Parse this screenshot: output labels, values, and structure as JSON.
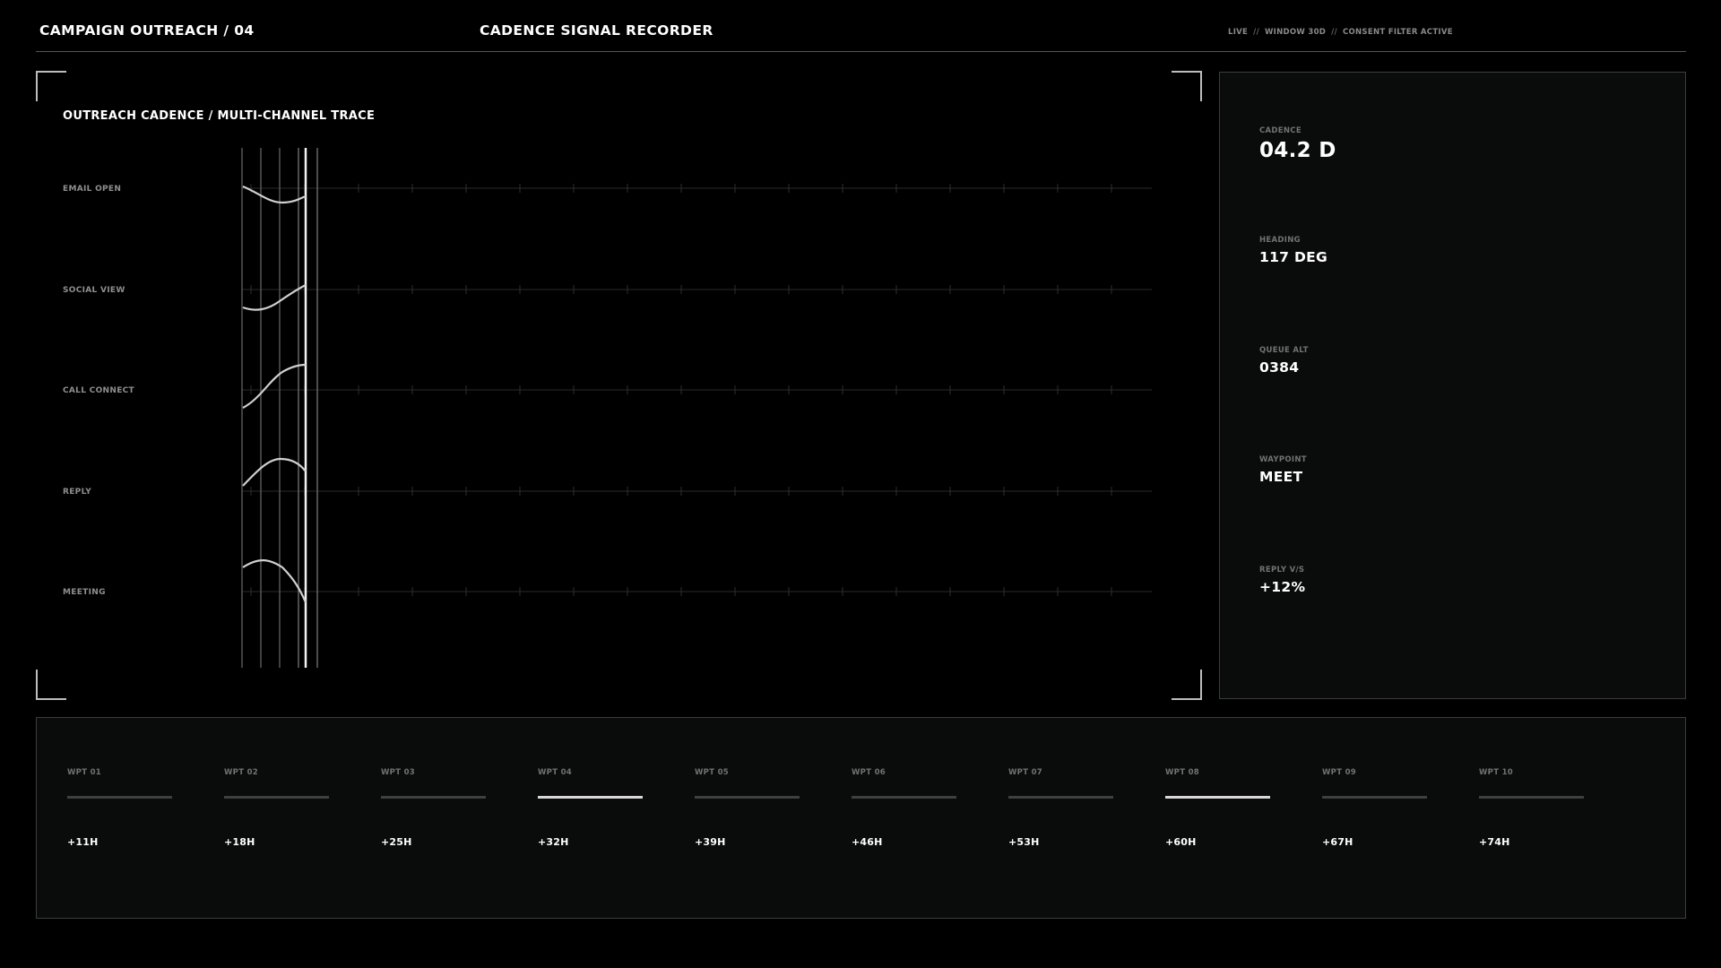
{
  "header": {
    "left_title": "CAMPAIGN OUTREACH / 04",
    "center_title": "CADENCE SIGNAL RECORDER",
    "status": [
      "LIVE",
      "WINDOW 30D",
      "CONSENT FILTER ACTIVE"
    ],
    "status_separator": "//"
  },
  "chart": {
    "title": "OUTREACH CADENCE / MULTI-CHANNEL TRACE",
    "lanes": [
      {
        "label": "EMAIL OPEN"
      },
      {
        "label": "SOCIAL VIEW"
      },
      {
        "label": "CALL CONNECT"
      },
      {
        "label": "REPLY"
      },
      {
        "label": "MEETING"
      }
    ]
  },
  "stats": [
    {
      "label": "CADENCE",
      "value": "04.2 D"
    },
    {
      "label": "HEADING",
      "value": "117 DEG"
    },
    {
      "label": "QUEUE ALT",
      "value": "0384"
    },
    {
      "label": "WAYPOINT",
      "value": "MEET"
    },
    {
      "label": "REPLY V/S",
      "value": "+12%"
    }
  ],
  "waypoints": [
    {
      "label": "WPT 01",
      "offset": "+11H",
      "active": false
    },
    {
      "label": "WPT 02",
      "offset": "+18H",
      "active": false
    },
    {
      "label": "WPT 03",
      "offset": "+25H",
      "active": false
    },
    {
      "label": "WPT 04",
      "offset": "+32H",
      "active": true
    },
    {
      "label": "WPT 05",
      "offset": "+39H",
      "active": false
    },
    {
      "label": "WPT 06",
      "offset": "+46H",
      "active": false
    },
    {
      "label": "WPT 07",
      "offset": "+53H",
      "active": false
    },
    {
      "label": "WPT 08",
      "offset": "+60H",
      "active": true
    },
    {
      "label": "WPT 09",
      "offset": "+67H",
      "active": false
    },
    {
      "label": "WPT 10",
      "offset": "+74H",
      "active": false
    }
  ],
  "colors": {
    "background": "#000000",
    "panel": "#0a0c0b",
    "border": "#3a3d3b",
    "trace": "#d0d0d0",
    "muted_text": "#6f7471",
    "active_bar": "#d8d8d8"
  }
}
